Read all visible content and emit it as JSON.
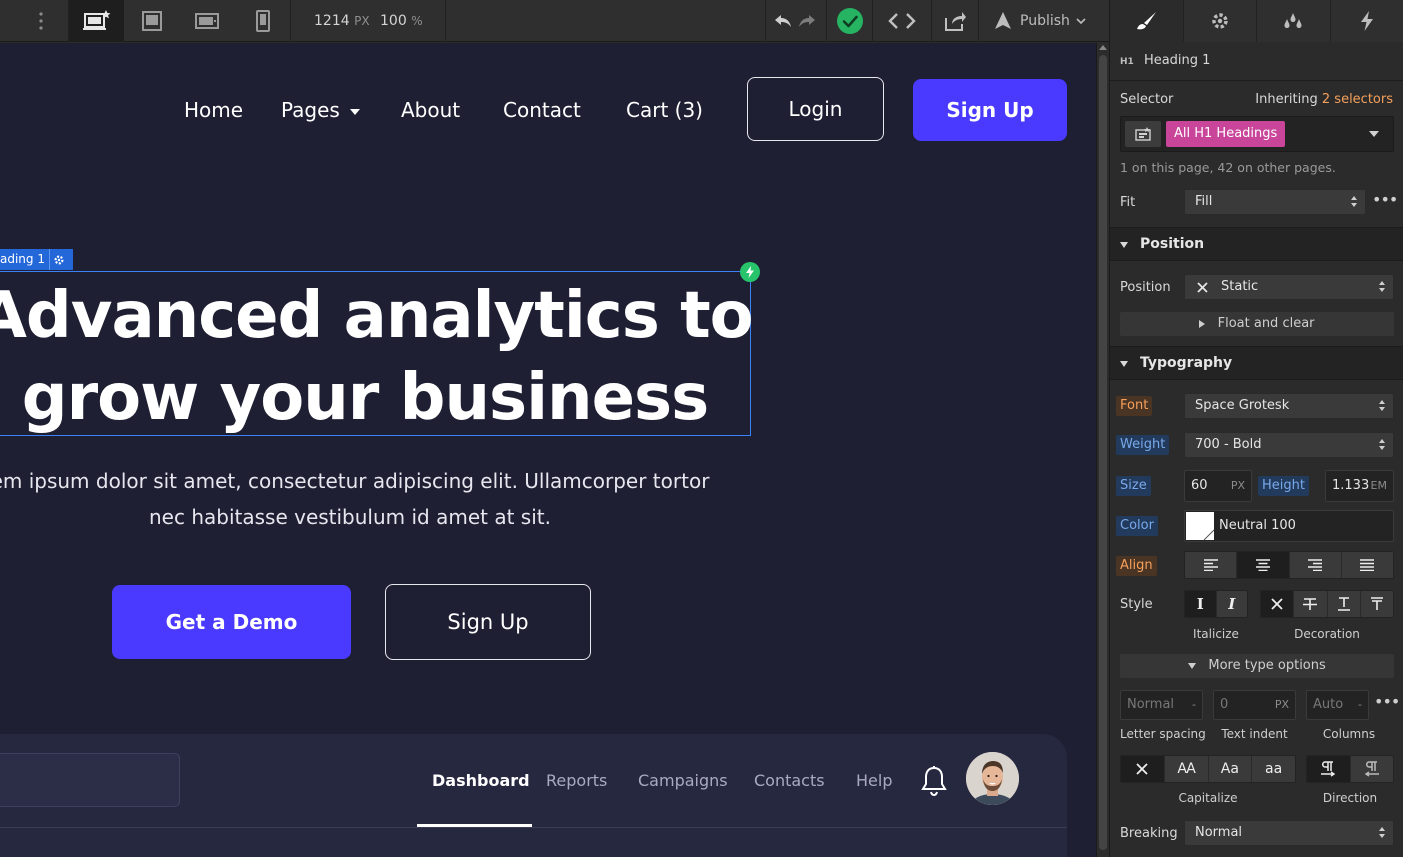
{
  "toolbar": {
    "width_value": "1214",
    "width_unit": "PX",
    "zoom_value": "100",
    "zoom_unit": "%",
    "publish_label": "Publish"
  },
  "site": {
    "nav": [
      "Home",
      "Pages",
      "About",
      "Contact",
      "Cart (3)"
    ],
    "login_label": "Login",
    "signup_label": "Sign Up",
    "selected_tag": "ading 1",
    "heading_line1": "Advanced analytics to",
    "heading_line2": "grow your business",
    "para_line1": "em ipsum dolor sit amet, consectetur adipiscing elit. Ullamcorper tortor",
    "para_line2": "nec habitasse vestibulum id amet at sit.",
    "demo_label": "Get a Demo",
    "signup2_label": "Sign Up",
    "dash_tabs": [
      "Dashboard",
      "Reports",
      "Campaigns",
      "Contacts",
      "Help"
    ]
  },
  "panel": {
    "element_badge": "H1",
    "element_name": "Heading 1",
    "selector_label": "Selector",
    "inheriting": "Inheriting",
    "inheriting_count": "2 selectors",
    "selector_chip": "All H1 Headings",
    "selector_note": "1 on this page, 42 on other pages.",
    "fit_label": "Fit",
    "fit_value": "Fill",
    "position_section": "Position",
    "position_label": "Position",
    "position_value": "Static",
    "float_label": "Float and clear",
    "typography_section": "Typography",
    "font_label": "Font",
    "font_value": "Space Grotesk",
    "weight_label": "Weight",
    "weight_value": "700 - Bold",
    "size_label": "Size",
    "size_value": "60",
    "size_unit": "PX",
    "height_label": "Height",
    "height_value": "1.133",
    "height_unit": "EM",
    "color_label": "Color",
    "color_value": "Neutral 100",
    "align_label": "Align",
    "style_label": "Style",
    "italicize_label": "Italicize",
    "decoration_label": "Decoration",
    "more_type_label": "More type options",
    "letter_spacing_value": "Normal",
    "letter_spacing_unit": "-",
    "text_indent_value": "0",
    "text_indent_unit": "PX",
    "columns_value": "Auto",
    "columns_unit": "-",
    "letter_spacing_label": "Letter spacing",
    "text_indent_label": "Text indent",
    "columns_label": "Columns",
    "capitalize_label": "Capitalize",
    "direction_label": "Direction",
    "breaking_label": "Breaking",
    "breaking_value": "Normal",
    "cap_opts": [
      "AA",
      "Aa",
      "aa"
    ]
  },
  "colors": {
    "accent": "#4a3aff",
    "canvas_bg": "#1e1f33",
    "selection": "#3b82f6",
    "chip": "#c8459a"
  }
}
